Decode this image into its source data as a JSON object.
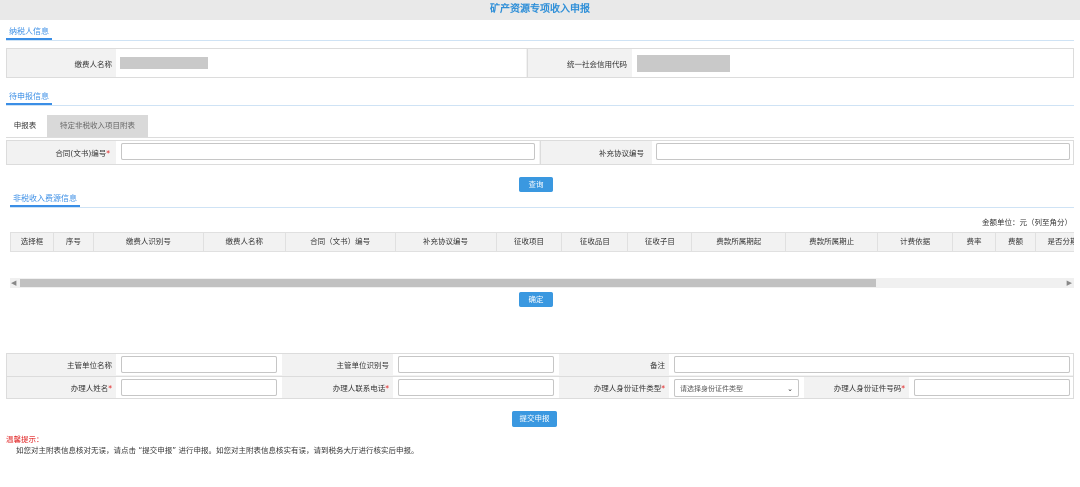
{
  "page_title": "矿产资源专项收入申报",
  "taxpayer": {
    "section_title": "纳税人信息",
    "payer_name_label": "缴费人名称",
    "credit_code_label": "统一社会信用代码"
  },
  "pending": {
    "section_title": "待申报信息",
    "tabs": [
      "申报表",
      "特定非税收入项目附表"
    ],
    "contract_label": "合同(文书)编号",
    "supplement_label": "补充协议编号",
    "query_button": "查询"
  },
  "source": {
    "section_title": "非税收入费源信息",
    "unit_note": "金额单位：元（列至角分）",
    "columns": [
      "选择框",
      "序号",
      "缴费人识别号",
      "缴费人名称",
      "合同（文书）编号",
      "补充协议编号",
      "征收项目",
      "征收品目",
      "征收子目",
      "费款所属期起",
      "费款所属期止",
      "计费依据",
      "费率",
      "费额",
      "是否分期"
    ],
    "confirm_button": "确定"
  },
  "bottom_form": {
    "dept_name_label": "主管单位名称",
    "dept_id_label": "主管单位识别号",
    "remark_label": "备注",
    "handler_name_label": "办理人姓名",
    "handler_phone_label": "办理人联系电话",
    "id_type_label": "办理人身份证件类型",
    "id_type_value": "请选择身份证件类型",
    "id_number_label": "办理人身份证件号码",
    "submit_button": "提交申报"
  },
  "tips": {
    "title": "温馨提示：",
    "text": "如您对主附表信息核对无误，请点击 “提交申报” 进行申报。如您对主附表信息核实有误，请到税务大厅进行核实后申报。"
  },
  "colors": {
    "accent": "#3a98e0",
    "required": "#e02020",
    "masked": "#c9c9c9"
  }
}
